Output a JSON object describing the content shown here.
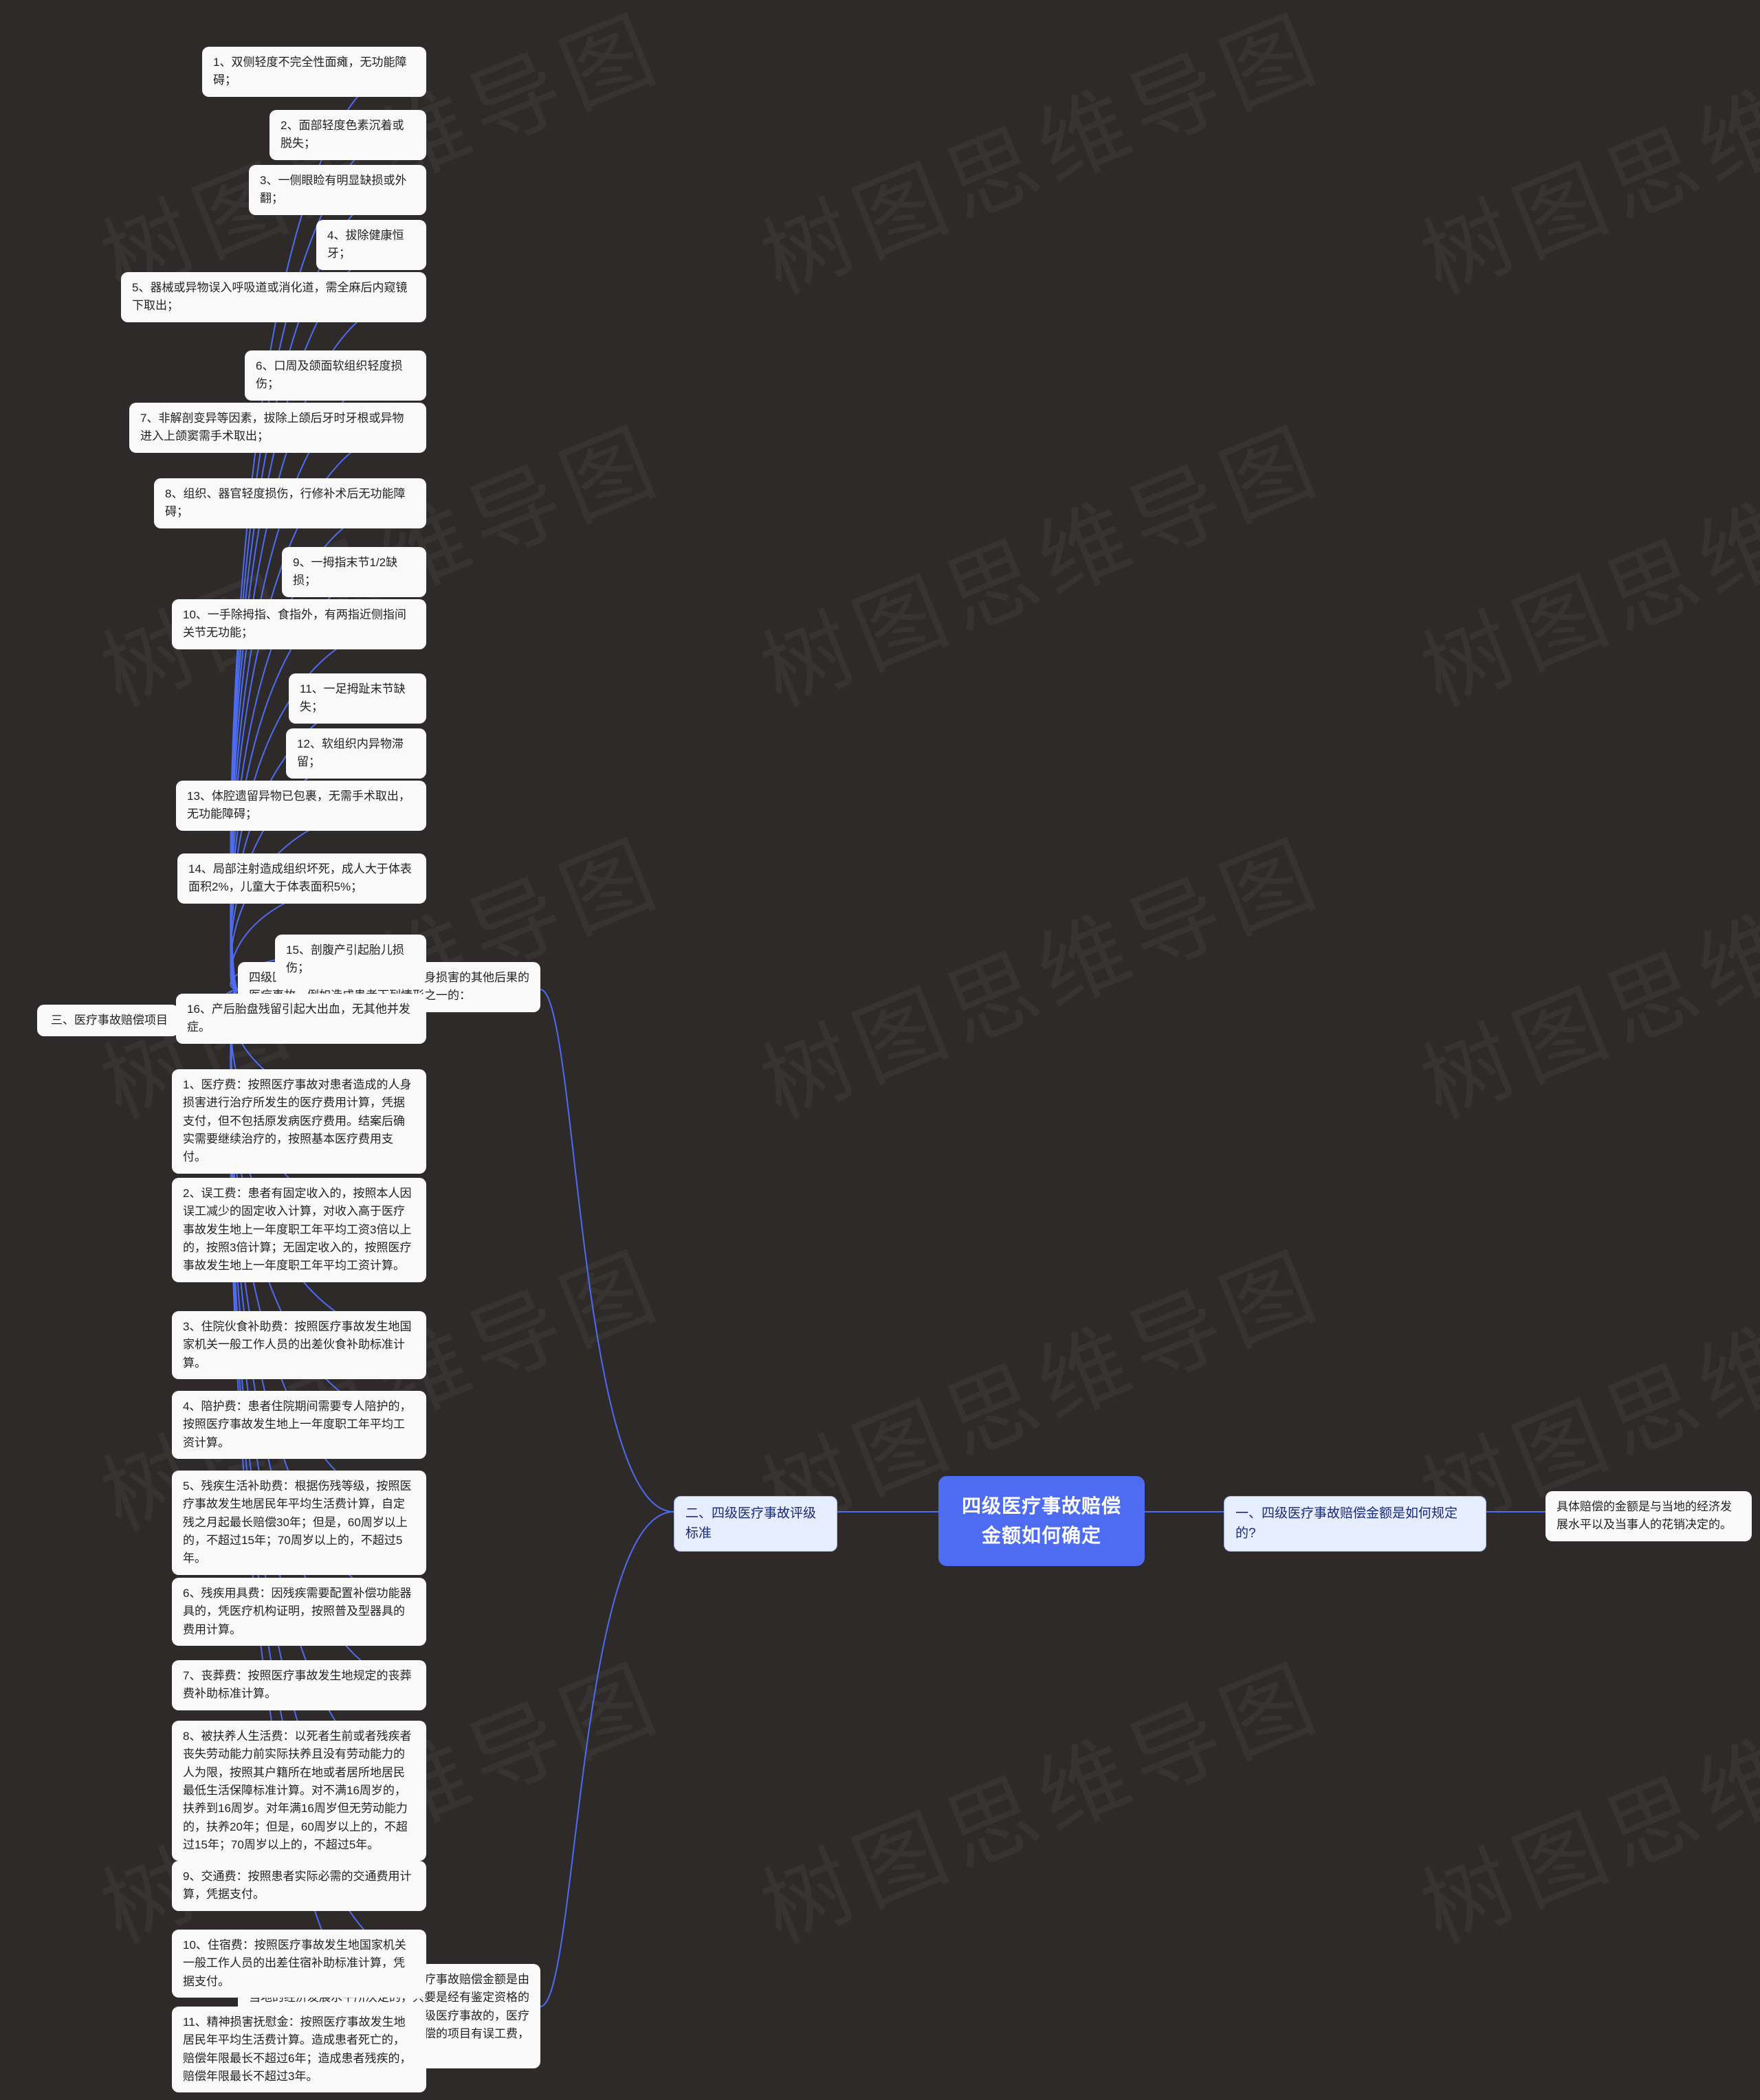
{
  "center": "四级医疗事故赔偿金额如何确定",
  "section1": {
    "title": "一、四级医疗事故赔偿金额是如何规定的?",
    "note": "具体赔偿的金额是与当地的经济发展水平以及当事人的花销决定的。"
  },
  "section2": {
    "title": "二、四级医疗事故评级标准",
    "intro": "四级医疗事故系指造成患者明显人身损害的其他后果的医疗事故。例如造成患者下列情形之一的：",
    "criteria": [
      "1、双侧轻度不完全性面瘫，无功能障碍；",
      "2、面部轻度色素沉着或脱失；",
      "3、一侧眼睑有明显缺损或外翻；",
      "4、拔除健康恒牙；",
      "5、器械或异物误入呼吸道或消化道，需全麻后内窥镜下取出；",
      "6、口周及颌面软组织轻度损伤；",
      "7、非解剖变异等因素，拔除上颌后牙时牙根或异物进入上颌窦需手术取出；",
      "8、组织、器官轻度损伤，行修补术后无功能障碍；",
      "9、一拇指末节1/2缺损；",
      "10、一手除拇指、食指外，有两指近侧指间关节无功能；",
      "11、一足拇趾末节缺失；",
      "12、软组织内异物滞留；",
      "13、体腔遗留异物已包裹，无需手术取出，无功能障碍；",
      "14、局部注射造成组织坏死，成人大于体表面积2%，儿童大于体表面积5%；",
      "15、剖腹产引起胎儿损伤；",
      "16、产后胎盘残留引起大出血，无其他并发症。"
    ]
  },
  "section3": {
    "title": "三、医疗事故赔偿项目",
    "items": [
      "1、医疗费：按照医疗事故对患者造成的人身损害进行治疗所发生的医疗费用计算，凭据支付，但不包括原发病医疗费用。结案后确实需要继续治疗的，按照基本医疗费用支付。",
      "2、误工费：患者有固定收入的，按照本人因误工减少的固定收入计算，对收入高于医疗事故发生地上一年度职工年平均工资3倍以上的，按照3倍计算；无固定收入的，按照医疗事故发生地上一年度职工年平均工资计算。",
      "3、住院伙食补助费：按照医疗事故发生地国家机关一般工作人员的出差伙食补助标准计算。",
      "4、陪护费：患者住院期间需要专人陪护的，按照医疗事故发生地上一年度职工年平均工资计算。",
      "5、残疾生活补助费：根据伤残等级，按照医疗事故发生地居民年平均生活费计算，自定残之月起最长赔偿30年；但是，60周岁以上的，不超过15年；70周岁以上的，不超过5年。",
      "6、残疾用具费：因残疾需要配置补偿功能器具的，凭医疗机构证明，按照普及型器具的费用计算。",
      "7、丧葬费：按照医疗事故发生地规定的丧葬费补助标准计算。",
      "8、被扶养人生活费：以死者生前或者残疾者丧失劳动能力前实际扶养且没有劳动能力的人为限，按照其户籍所在地或者居所地居民最低生活保障标准计算。对不满16周岁的，扶养到16周岁。对年满16周岁但无劳动能力的，扶养20年；但是，60周岁以上的，不超过15年；70周岁以上的，不超过5年。",
      "9、交通费：按照患者实际必需的交通费用计算，凭据支付。",
      "10、住宿费：按照医疗事故发生地国家机关一般工作人员的出差住宿补助标准计算，凭据支付。",
      "11、精神损害抚慰金：按照医疗事故发生地居民年平均生活费计算。造成患者死亡的，赔偿年限最长不超过6年；造成患者残疾的，赔偿年限最长不超过3年。"
    ],
    "conclusion": "由以上信息我们可以看出，四级医疗事故赔偿金额是由当地的经济发展水平所决定的，只要是经有鉴定资格的鉴定机关进行鉴定之后，确定为四级医疗事故的，医疗机构需要承担相应的赔偿责任。赔偿的项目有误工费，误食食，医疗费等。"
  },
  "watermark": "树图思维导图"
}
